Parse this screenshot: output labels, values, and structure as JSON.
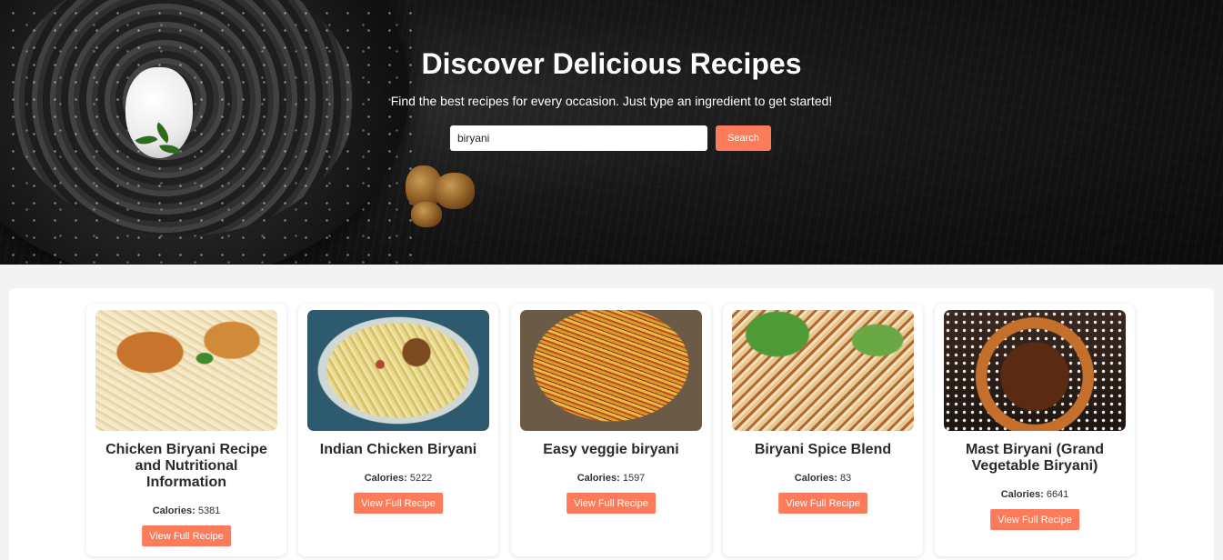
{
  "hero": {
    "title": "Discover Delicious Recipes",
    "subtitle": "Find the best recipes for every occasion. Just type an ingredient to get started!",
    "search": {
      "value": "biryani",
      "button_label": "Search"
    }
  },
  "results": [
    {
      "title": "Chicken Biryani Recipe and Nutritional Information",
      "calories_label": "Calories:",
      "calories": "5381",
      "button_label": "View Full Recipe",
      "image": "chicken-biryani-photo"
    },
    {
      "title": "Indian Chicken Biryani",
      "calories_label": "Calories:",
      "calories": "5222",
      "button_label": "View Full Recipe",
      "image": "indian-chicken-biryani-photo"
    },
    {
      "title": "Easy veggie biryani",
      "calories_label": "Calories:",
      "calories": "1597",
      "button_label": "View Full Recipe",
      "image": "veggie-biryani-photo"
    },
    {
      "title": "Biryani Spice Blend",
      "calories_label": "Calories:",
      "calories": "83",
      "button_label": "View Full Recipe",
      "image": "spice-blend-photo"
    },
    {
      "title": "Mast Biryani (Grand Vegetable Biryani)",
      "calories_label": "Calories:",
      "calories": "6641",
      "button_label": "View Full Recipe",
      "image": "mast-biryani-photo"
    }
  ],
  "colors": {
    "accent": "#fb7b5b",
    "hero_bg": "#111111",
    "page_bg": "#f3f3f3"
  }
}
